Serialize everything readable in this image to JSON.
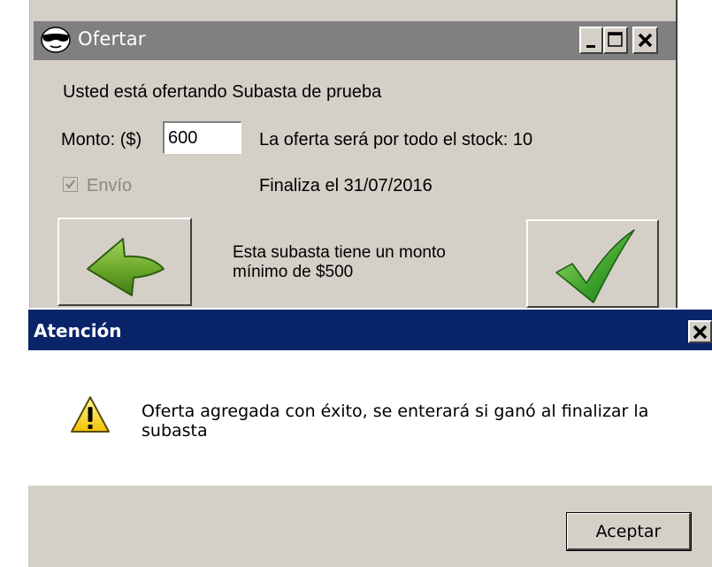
{
  "main_window": {
    "title": "Ofertar",
    "title_icon": "sunglasses-face-icon",
    "offering_text": "Usted está ofertando Subasta de prueba",
    "amount_label": "Monto: ($)",
    "amount_value": "600",
    "stock_text": "La oferta será por todo el stock: 10",
    "shipping_label": "Envío",
    "shipping_checked": true,
    "ends_text": "Finaliza el 31/07/2016",
    "min_amount_line1": "Esta subasta tiene un monto",
    "min_amount_line2": "mínimo de $500",
    "back_icon": "green-back-arrow-icon",
    "confirm_icon": "green-checkmark-icon"
  },
  "dialog": {
    "title": "Atención",
    "icon": "warning-icon",
    "message": "Oferta agregada con éxito, se enterará si ganó al finalizar la subasta",
    "accept_label": "Aceptar"
  },
  "colors": {
    "inactive_titlebar": "#808080",
    "active_titlebar": "#0a246a",
    "window_face": "#d4d0c8"
  }
}
